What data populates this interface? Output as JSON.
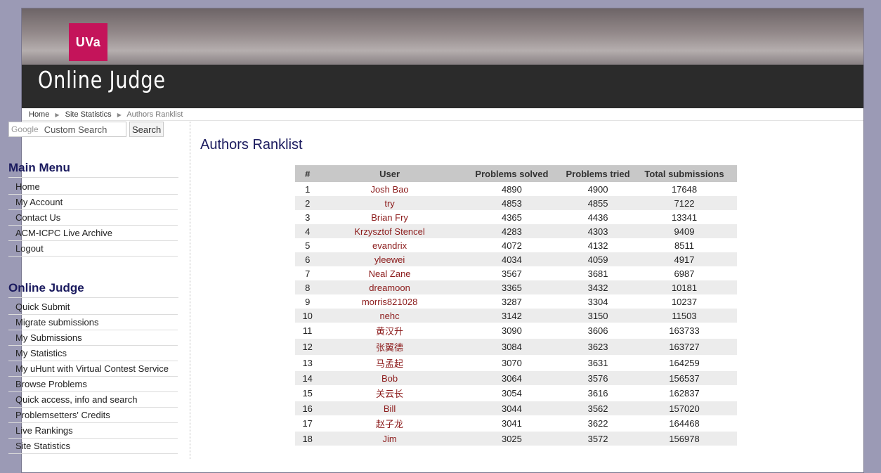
{
  "header": {
    "logo_text": "UVa",
    "site_title": "Online Judge"
  },
  "breadcrumb": {
    "home": "Home",
    "stats": "Site Statistics",
    "current": "Authors Ranklist"
  },
  "search": {
    "placeholder_brand": "Google",
    "placeholder": "Custom Search",
    "button": "Search"
  },
  "main_menu": {
    "title": "Main Menu",
    "items": [
      "Home",
      "My Account",
      "Contact Us",
      "ACM-ICPC Live Archive",
      "Logout"
    ]
  },
  "oj_menu": {
    "title": "Online Judge",
    "items": [
      "Quick Submit",
      "Migrate submissions",
      "My Submissions",
      "My Statistics",
      "My uHunt with Virtual Contest Service",
      "Browse Problems",
      "Quick access, info and search",
      "Problemsetters' Credits",
      "Live Rankings",
      "Site Statistics"
    ]
  },
  "page_title": "Authors Ranklist",
  "table": {
    "headers": [
      "#",
      "User",
      "Problems solved",
      "Problems tried",
      "Total submissions"
    ],
    "rows": [
      [
        "1",
        "Josh Bao",
        "4890",
        "4900",
        "17648"
      ],
      [
        "2",
        "try",
        "4853",
        "4855",
        "7122"
      ],
      [
        "3",
        "Brian Fry",
        "4365",
        "4436",
        "13341"
      ],
      [
        "4",
        "Krzysztof Stencel",
        "4283",
        "4303",
        "9409"
      ],
      [
        "5",
        "evandrix",
        "4072",
        "4132",
        "8511"
      ],
      [
        "6",
        "yleewei",
        "4034",
        "4059",
        "4917"
      ],
      [
        "7",
        "Neal Zane",
        "3567",
        "3681",
        "6987"
      ],
      [
        "8",
        "dreamoon",
        "3365",
        "3432",
        "10181"
      ],
      [
        "9",
        "morris821028",
        "3287",
        "3304",
        "10237"
      ],
      [
        "10",
        "nehc",
        "3142",
        "3150",
        "11503"
      ],
      [
        "11",
        "黄汉升",
        "3090",
        "3606",
        "163733"
      ],
      [
        "12",
        "张翼德",
        "3084",
        "3623",
        "163727"
      ],
      [
        "13",
        "马孟起",
        "3070",
        "3631",
        "164259"
      ],
      [
        "14",
        "Bob",
        "3064",
        "3576",
        "156537"
      ],
      [
        "15",
        "关云长",
        "3054",
        "3616",
        "162837"
      ],
      [
        "16",
        "Bill",
        "3044",
        "3562",
        "157020"
      ],
      [
        "17",
        "赵子龙",
        "3041",
        "3622",
        "164468"
      ],
      [
        "18",
        "Jim",
        "3025",
        "3572",
        "156978"
      ]
    ]
  }
}
